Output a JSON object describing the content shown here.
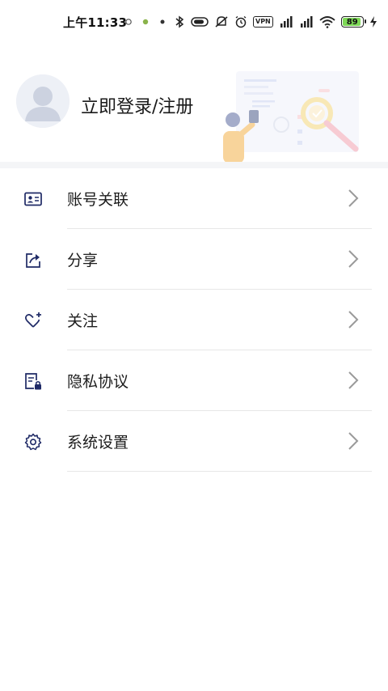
{
  "status_bar": {
    "time": "上午11:33",
    "vpn_label": "VPN",
    "battery_level": "89",
    "icons": [
      "notification-icon",
      "notification-icon",
      "notification-icon",
      "bluetooth-icon",
      "toggle-icon",
      "mute-icon",
      "alarm-icon",
      "vpn-icon",
      "signal-icon",
      "signal-icon",
      "wifi-icon",
      "battery-icon",
      "charging-icon"
    ]
  },
  "header": {
    "login_label": "立即登录/注册",
    "avatar_icon": "default-avatar-icon"
  },
  "menu": {
    "items": [
      {
        "label": "账号关联",
        "icon": "id-card-icon"
      },
      {
        "label": "分享",
        "icon": "share-icon"
      },
      {
        "label": "关注",
        "icon": "heart-plus-icon"
      },
      {
        "label": "隐私协议",
        "icon": "document-lock-icon"
      },
      {
        "label": "系统设置",
        "icon": "gear-icon"
      }
    ]
  },
  "colors": {
    "accent_navy": "#1f2a66",
    "separator": "#e7e7e7",
    "battery_green": "#7ed957"
  }
}
